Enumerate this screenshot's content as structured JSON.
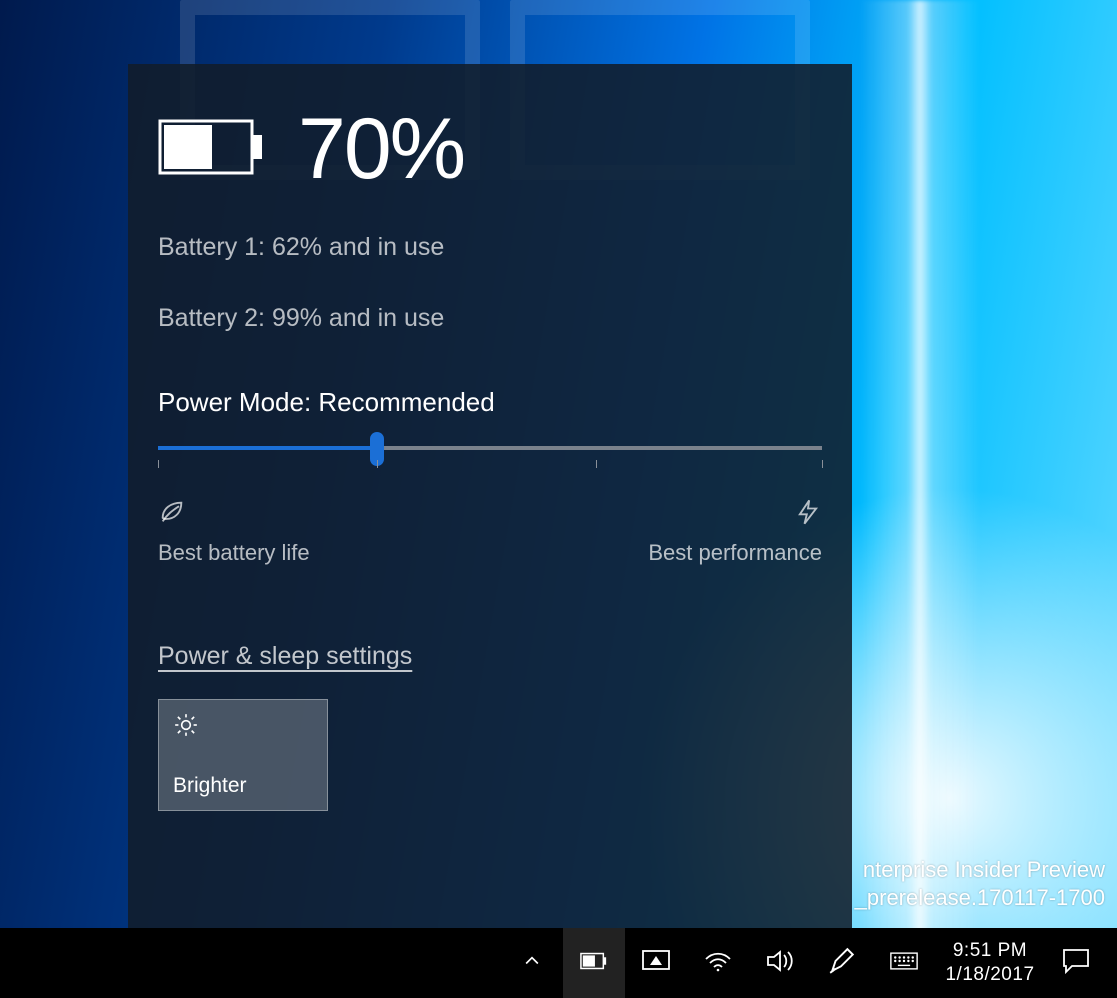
{
  "flyout": {
    "percent": "70%",
    "battery1": "Battery 1: 62% and in use",
    "battery2": "Battery 2: 99% and in use",
    "power_mode": "Power Mode: Recommended",
    "best_battery": "Best battery life",
    "best_perf": "Best performance",
    "settings_link": "Power & sleep settings",
    "brightness_tile": "Brighter",
    "slider_position_percent": 33
  },
  "watermark": {
    "line1": "nterprise Insider Preview",
    "line2": "_prerelease.170117-1700"
  },
  "clock": {
    "time": "9:51 PM",
    "date": "1/18/2017"
  },
  "tray_icons": {
    "chevron": "chevron-up-icon",
    "battery": "battery-icon",
    "cast": "project-icon",
    "wifi": "wifi-icon",
    "volume": "volume-icon",
    "pen": "pen-icon",
    "keyboard": "keyboard-icon",
    "action": "action-center-icon"
  }
}
